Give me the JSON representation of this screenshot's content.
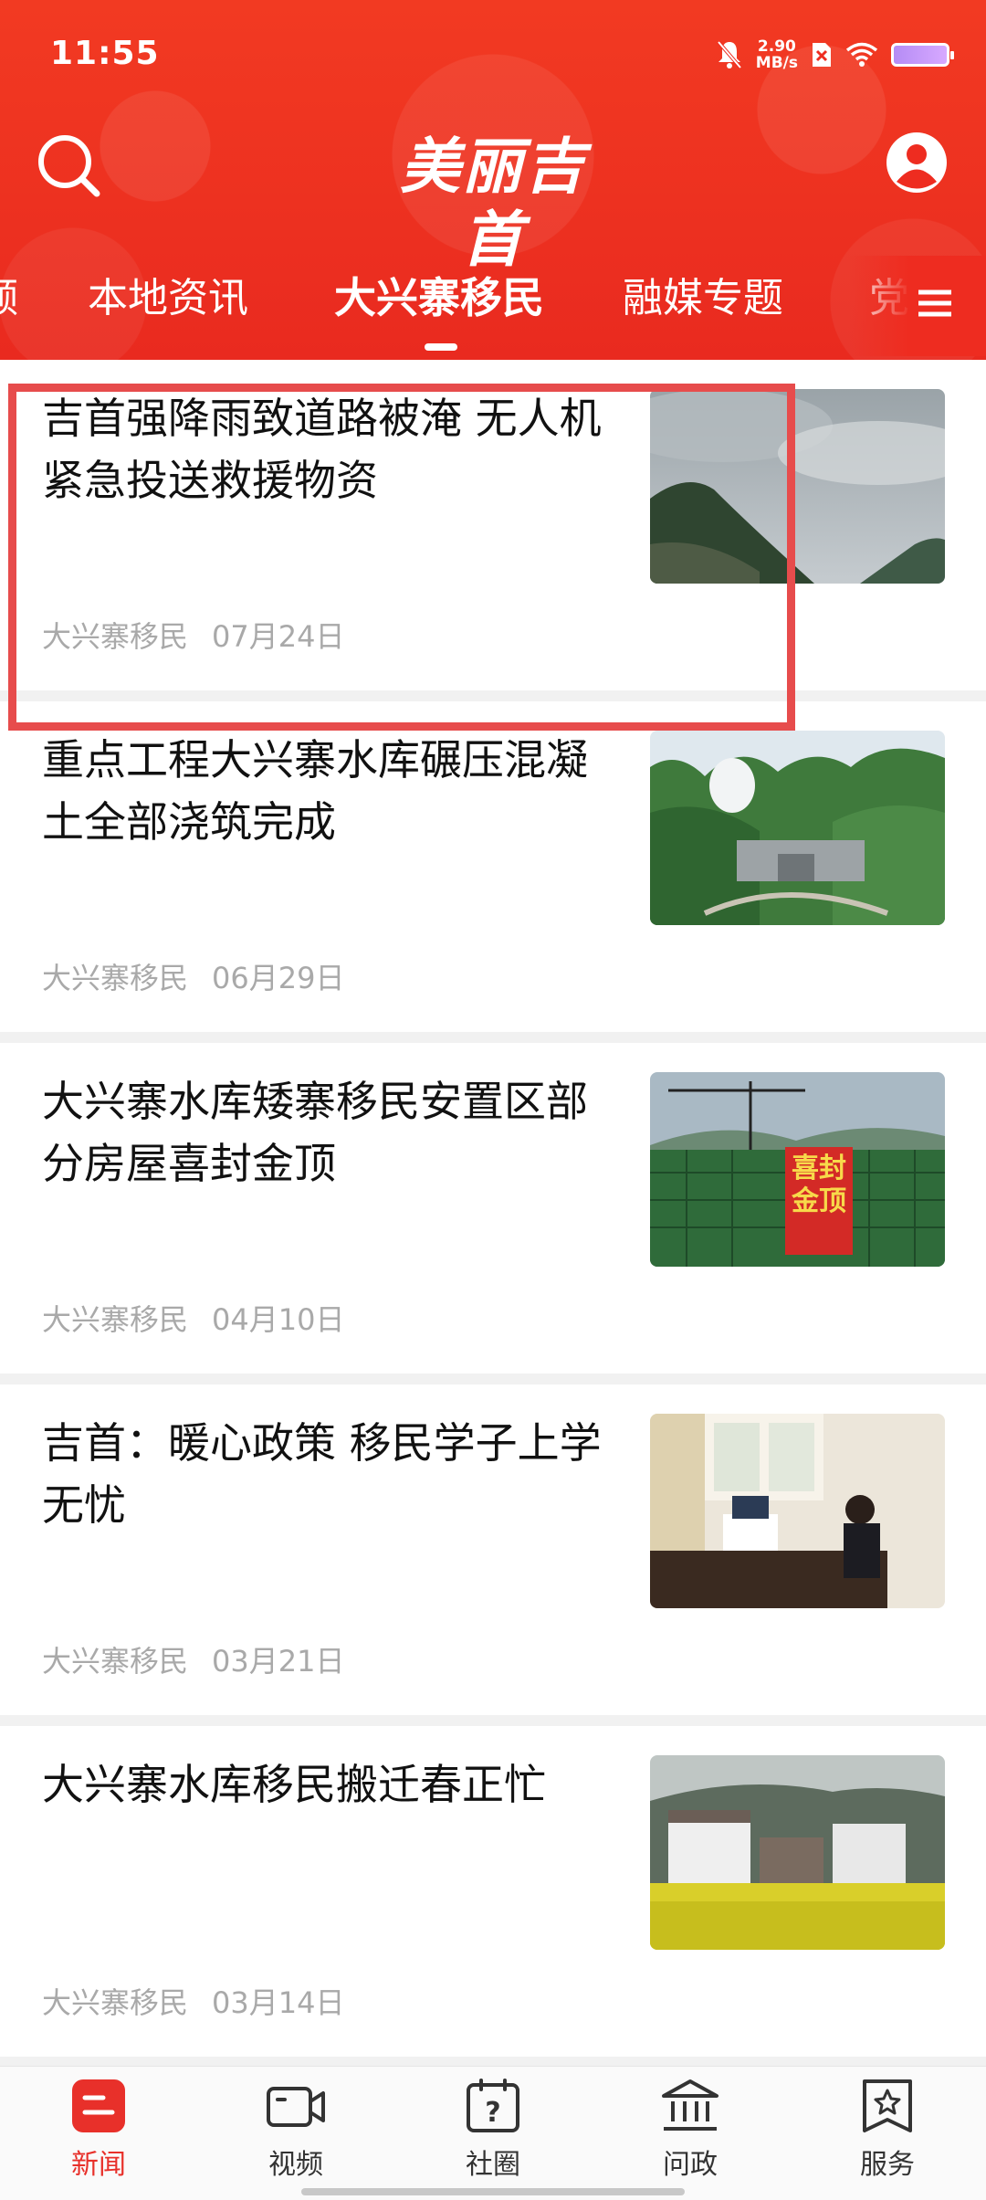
{
  "status_bar": {
    "time": "11:55",
    "net_speed_value": "2.90",
    "net_speed_unit": "MB/s"
  },
  "header": {
    "logo_text": "美丽吉首"
  },
  "tabs": [
    {
      "label": "频",
      "active": false
    },
    {
      "label": "本地资讯",
      "active": false
    },
    {
      "label": "大兴寨移民",
      "active": true
    },
    {
      "label": "融媒专题",
      "active": false
    },
    {
      "label": "党",
      "active": false
    }
  ],
  "news": [
    {
      "title": "吉首强降雨致道路被淹 无人机紧急投送救援物资",
      "source": "大兴寨移民",
      "date": "07月24日"
    },
    {
      "title": "重点工程大兴寨水库碾压混凝土全部浇筑完成",
      "source": "大兴寨移民",
      "date": "06月29日"
    },
    {
      "title": "大兴寨水库矮寨移民安置区部分房屋喜封金顶",
      "source": "大兴寨移民",
      "date": "04月10日",
      "thumb_text": "喜封金顶"
    },
    {
      "title": "吉首：暖心政策 移民学子上学无忧",
      "source": "大兴寨移民",
      "date": "03月21日"
    },
    {
      "title": "大兴寨水库移民搬迁春正忙",
      "source": "大兴寨移民",
      "date": "03月14日"
    }
  ],
  "bottom_nav": [
    {
      "label": "新闻",
      "icon": "news-icon",
      "active": true
    },
    {
      "label": "视频",
      "icon": "video-icon",
      "active": false
    },
    {
      "label": "社圈",
      "icon": "community-icon",
      "active": false
    },
    {
      "label": "问政",
      "icon": "government-icon",
      "active": false
    },
    {
      "label": "服务",
      "icon": "service-icon",
      "active": false
    }
  ],
  "colors": {
    "brand_red": "#ee2c20",
    "highlight_box": "#e74c4c",
    "meta_gray": "#a9a9a9"
  }
}
